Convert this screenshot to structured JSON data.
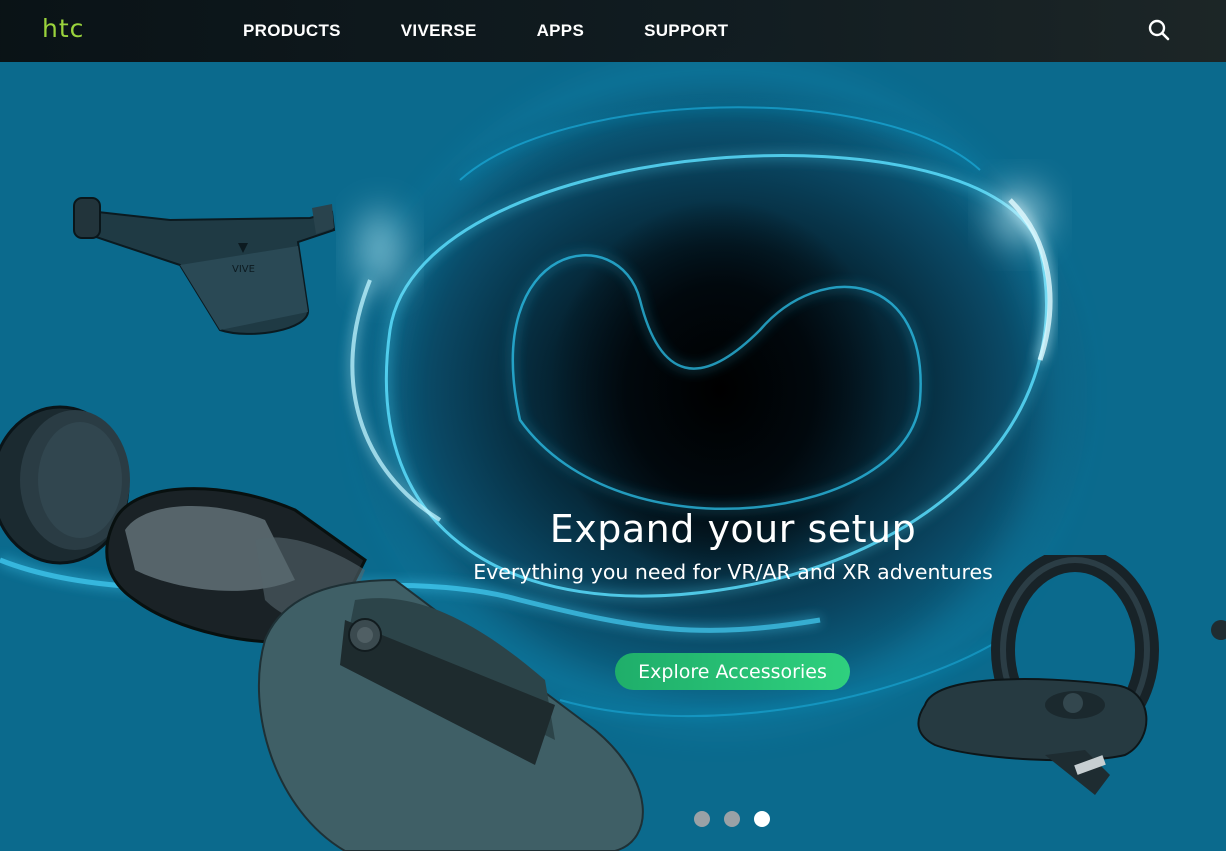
{
  "nav": {
    "logo": "htc",
    "items": [
      {
        "label": "PRODUCTS"
      },
      {
        "label": "VIVERSE"
      },
      {
        "label": "APPS"
      },
      {
        "label": "SUPPORT"
      }
    ],
    "search_icon": "search-icon"
  },
  "hero": {
    "title": "Expand your setup",
    "subtitle": "Everything you need for VR/AR and XR adventures",
    "cta_label": "Explore Accessories",
    "slide_count": 3,
    "active_slide": 3,
    "wireless_adapter_badge": "VIVE"
  },
  "colors": {
    "logo": "#9ad33c",
    "cta_start": "#1fae6a",
    "cta_end": "#2fd07e",
    "glow": "#3fd2ff"
  }
}
